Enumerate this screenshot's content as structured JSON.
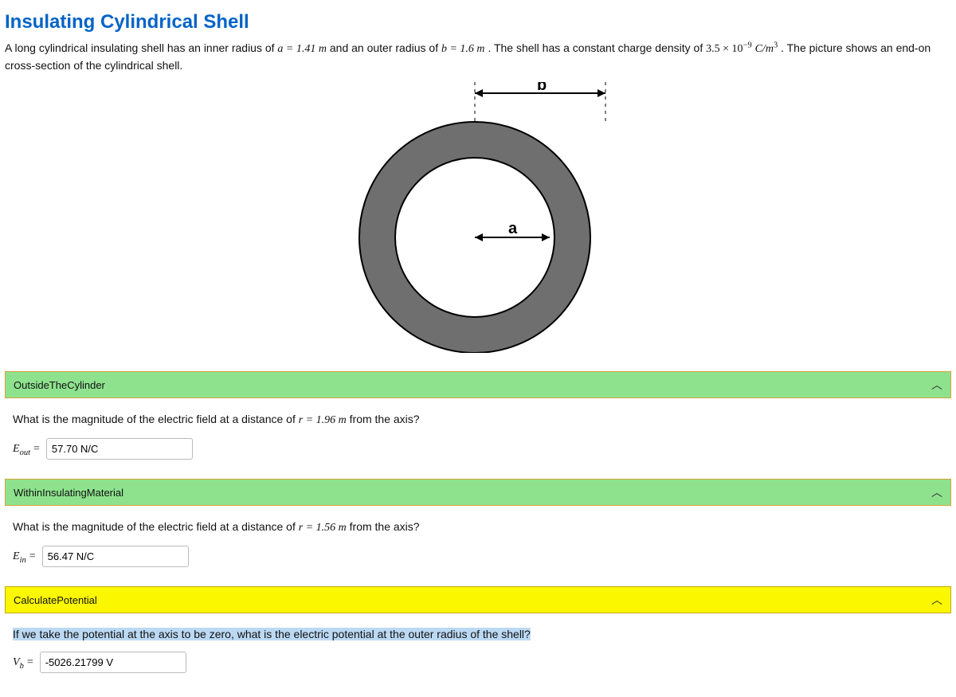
{
  "title": "Insulating Cylindrical Shell",
  "statement": {
    "t1": "A long cylindrical insulating shell has an inner radius of ",
    "a_eq": "a = 1.41 m",
    "t2": " and an outer radius of ",
    "b_eq": "b = 1.6 m",
    "t3": ". The shell has a constant charge density of ",
    "rho_val": "3.5 × 10",
    "rho_exp": "−9",
    "rho_unit_pre": " C/m",
    "rho_unit_exp": "3",
    "t4": ". The picture shows an end-on cross-section of the cylindrical shell."
  },
  "figure": {
    "label_a": "a",
    "label_b": "b"
  },
  "sections": [
    {
      "header": "OutsideTheCylinder",
      "style": "green",
      "question_pre": "What is the magnitude of the electric field at a distance of ",
      "r_eq": "r = 1.96 m",
      "question_post": " from the axis?",
      "symbol": "E",
      "symbol_sub": "out",
      "value": "57.70 N/C",
      "highlight": false
    },
    {
      "header": "WithinInsulatingMaterial",
      "style": "green",
      "question_pre": "What is the magnitude of the electric field at a distance of ",
      "r_eq": "r = 1.56 m",
      "question_post": " from the axis?",
      "symbol": "E",
      "symbol_sub": "in",
      "value": "56.47 N/C",
      "highlight": false
    },
    {
      "header": "CalculatePotential",
      "style": "yellow",
      "question_pre": "If we take the potential at the axis to be zero, what is the electric potential at the outer radius of the shell?",
      "r_eq": "",
      "question_post": "",
      "symbol": "V",
      "symbol_sub": "b",
      "value": "-5026.21799 V",
      "highlight": true
    }
  ]
}
